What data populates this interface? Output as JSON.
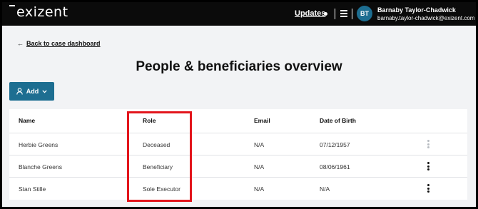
{
  "header": {
    "logo_text": "exizent",
    "updates_label": "Updates",
    "user": {
      "initials": "BT",
      "name": "Barnaby Taylor-Chadwick",
      "email": "barnaby.taylor-chadwick@exizent.com",
      "avatar_color": "#1d6e91"
    }
  },
  "nav": {
    "back_label": "Back to case dashboard",
    "back_icon": "arrow-left-icon"
  },
  "page": {
    "title": "People & beneficiaries overview"
  },
  "toolbar": {
    "add_label": "Add",
    "add_icon": "person-icon",
    "add_color": "#1d6e91"
  },
  "table": {
    "columns": [
      "Name",
      "Role",
      "Email",
      "Date of Birth"
    ],
    "rows": [
      {
        "name": "Herbie Greens",
        "role": "Deceased",
        "email": "N/A",
        "dob": "07/12/1957"
      },
      {
        "name": "Blanche Greens",
        "role": "Beneficiary",
        "email": "N/A",
        "dob": "08/06/1961"
      },
      {
        "name": "Stan Stille",
        "role": "Sole Executor",
        "email": "N/A",
        "dob": "N/A"
      }
    ]
  },
  "annotation": {
    "highlight_color": "#e3151c"
  }
}
